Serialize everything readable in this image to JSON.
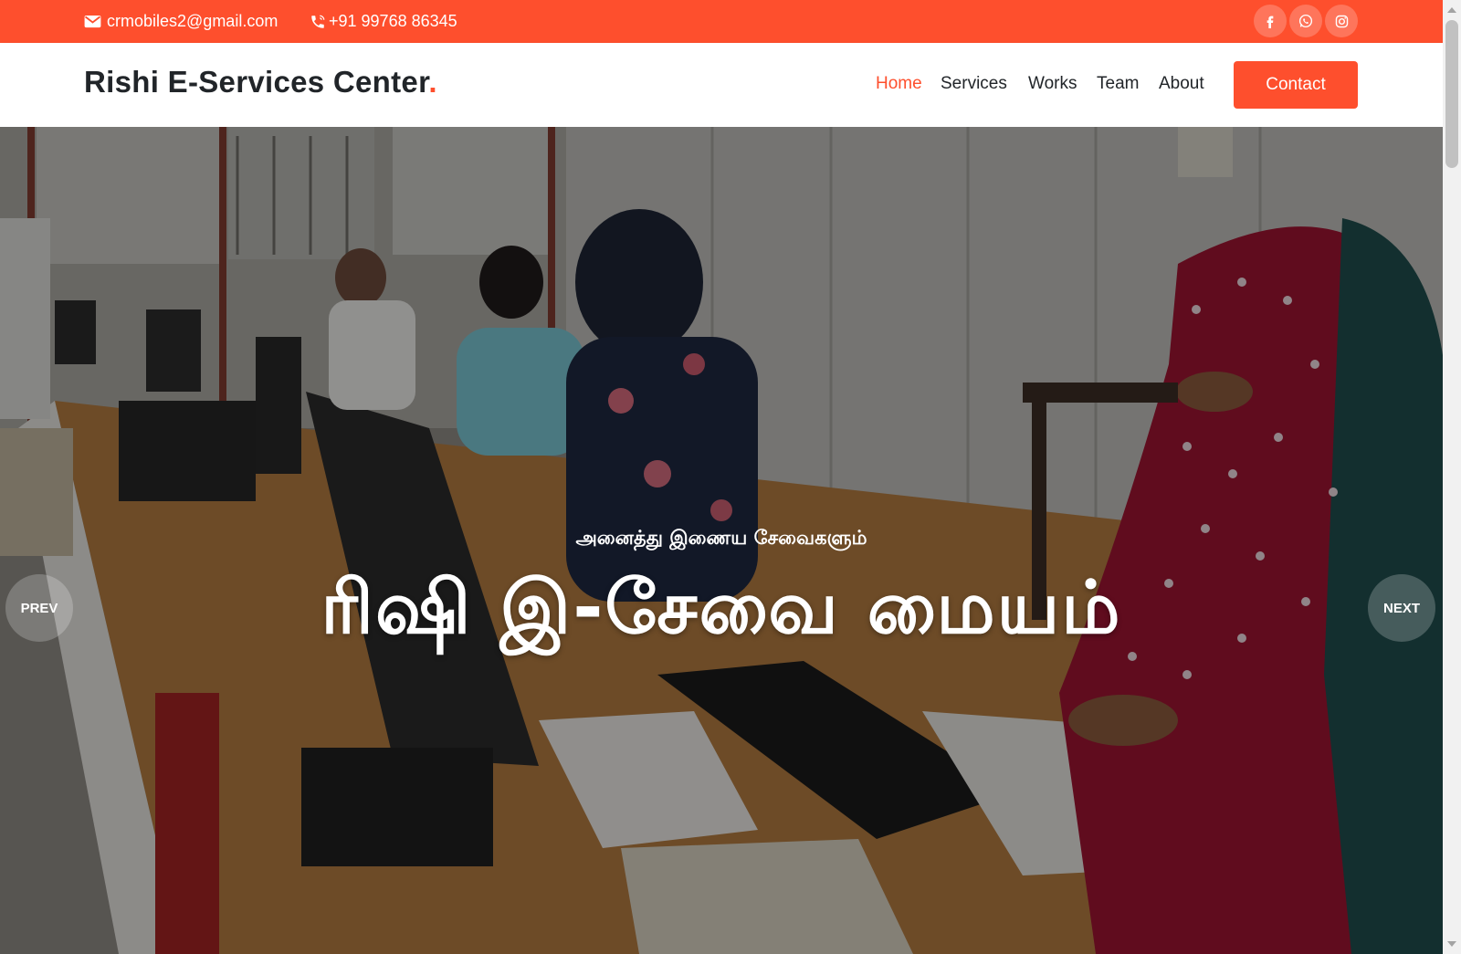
{
  "topbar": {
    "email": "crmobiles2@gmail.com",
    "phone": "+91 99768 86345",
    "email_icon": "mail-icon",
    "phone_icon": "phone-icon",
    "social_icons": [
      "facebook-icon",
      "whatsapp-icon",
      "instagram-icon"
    ],
    "background_color": "#fe4f2d"
  },
  "header": {
    "logo_text": "Rishi E-Services Center",
    "logo_dot": ".",
    "nav": {
      "home": "Home",
      "services": "Services",
      "works": "Works",
      "team": "Team",
      "about": "About"
    },
    "active_nav": "home",
    "contact_button": "Contact",
    "accent_color": "#fe4f2d"
  },
  "hero": {
    "subtitle": "அனைத்து இணைய சேவைகளும்",
    "title": "ரிஷி இ-சேவை மையம்",
    "prev_label": "PREV",
    "next_label": "NEXT"
  }
}
